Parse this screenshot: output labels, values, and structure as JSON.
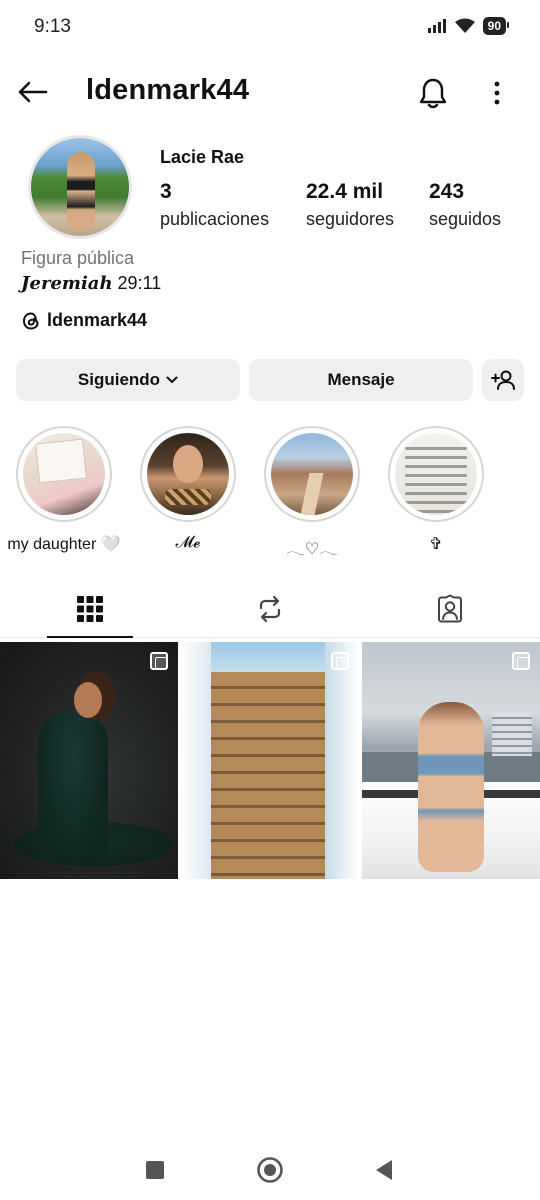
{
  "status_bar": {
    "time": "9:13",
    "battery": "90"
  },
  "header": {
    "username": "ldenmark44"
  },
  "profile": {
    "display_name": "Lacie Rae",
    "stats": [
      {
        "value": "3",
        "label": "publicaciones"
      },
      {
        "value": "22.4 mil",
        "label": "seguidores"
      },
      {
        "value": "243",
        "label": "seguidos"
      }
    ],
    "category": "Figura pública",
    "bio_prefix": "Jeremiah",
    "bio_suffix": " 29:11",
    "threads_handle": "ldenmark44"
  },
  "actions": {
    "following_label": "Siguiendo",
    "message_label": "Mensaje"
  },
  "highlights": [
    {
      "label": "my daughter 🤍"
    },
    {
      "label": "𝓜𝓮"
    },
    {
      "label": "𓂃♡𓂃"
    },
    {
      "label": "✞"
    }
  ],
  "tabs": [
    {
      "name": "posts-grid",
      "icon": "grid-icon"
    },
    {
      "name": "reposts",
      "icon": "repost-icon"
    },
    {
      "name": "tagged",
      "icon": "tagged-person-icon"
    }
  ],
  "posts": [
    {
      "icon": "multiple-photos-icon"
    },
    {
      "icon": "multiple-photos-icon"
    },
    {
      "icon": "multiple-photos-icon"
    }
  ],
  "colors": {
    "button_bg": "#efeff2",
    "muted_text": "#737373",
    "text": "#111111"
  }
}
